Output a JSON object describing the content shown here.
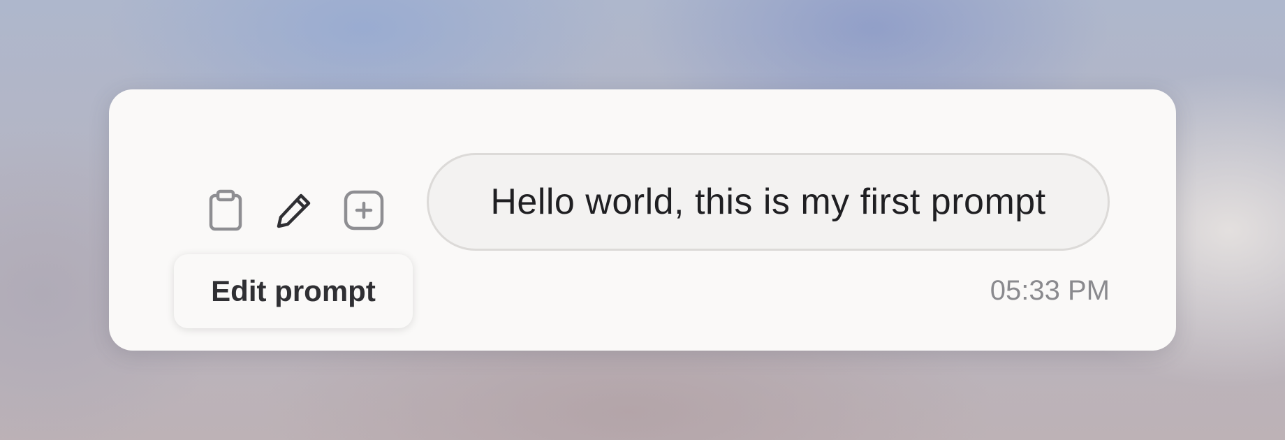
{
  "message": {
    "text": "Hello world, this is my first prompt",
    "timestamp": "05:33 PM"
  },
  "actions": [
    {
      "icon": "clipboard-icon",
      "label": "Copy"
    },
    {
      "icon": "pencil-icon",
      "label": "Edit prompt"
    },
    {
      "icon": "plus-square-icon",
      "label": "Add"
    }
  ],
  "tooltip": {
    "text": "Edit prompt"
  },
  "colors": {
    "card_background": "#faf9f8",
    "bubble_background": "#f3f2f1",
    "bubble_border": "#dcdad8",
    "text_primary": "#1f1f22",
    "timestamp": "#8a8a8e",
    "icon_muted": "#8e8e92",
    "icon_active": "#2f2f33"
  }
}
